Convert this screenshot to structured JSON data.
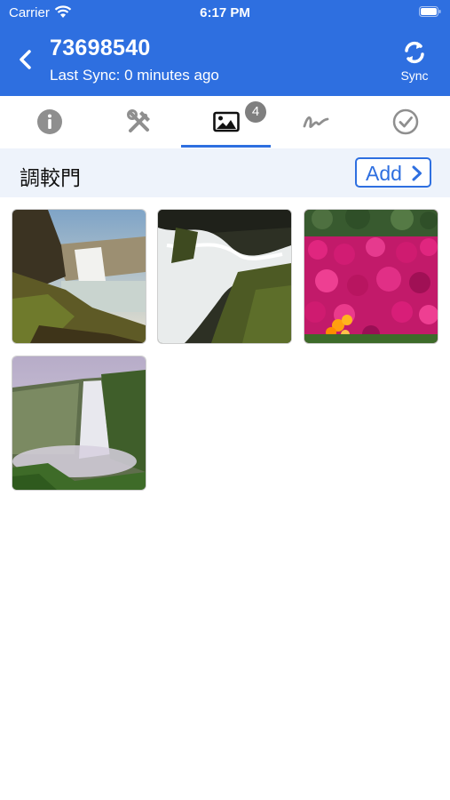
{
  "status_bar": {
    "carrier": "Carrier",
    "time": "6:17 PM"
  },
  "header": {
    "title": "73698540",
    "subtitle": "Last Sync: 0 minutes ago",
    "sync_label": "Sync"
  },
  "tabs": [
    {
      "icon": "info-icon",
      "active": false
    },
    {
      "icon": "tools-icon",
      "active": false
    },
    {
      "icon": "image-icon",
      "active": true,
      "badge": "4"
    },
    {
      "icon": "signature-icon",
      "active": false
    },
    {
      "icon": "check-circle-icon",
      "active": false
    }
  ],
  "section": {
    "title": "調較門",
    "add_label": "Add"
  },
  "photos": [
    {
      "subject": "waterfall-cliff"
    },
    {
      "subject": "waterfall-closeup"
    },
    {
      "subject": "pink-flowers"
    },
    {
      "subject": "waterfall-mist"
    }
  ],
  "colors": {
    "primary": "#2e6fe0",
    "tab_icon": "#8f8f8f",
    "badge": "#7f7f7f",
    "section_bg": "#eef3fb"
  }
}
